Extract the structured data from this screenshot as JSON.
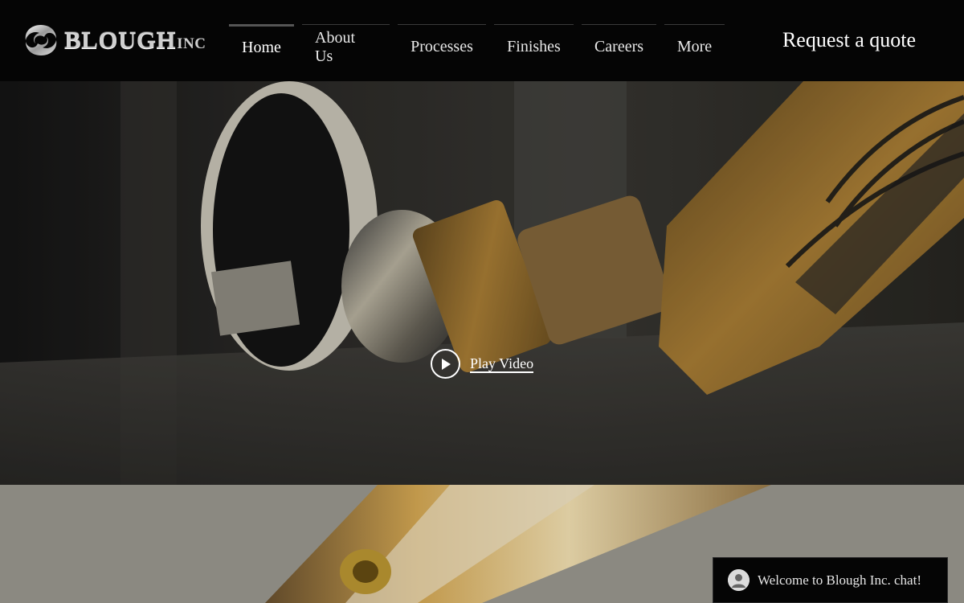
{
  "header": {
    "logo": {
      "name": "BLOUGH",
      "suffix": "INC",
      "icon": "swirl-logo-icon"
    },
    "nav": [
      {
        "label": "Home",
        "active": true
      },
      {
        "label": "About Us",
        "active": false
      },
      {
        "label": "Processes",
        "active": false
      },
      {
        "label": "Finishes",
        "active": false
      },
      {
        "label": "Careers",
        "active": false
      },
      {
        "label": "More",
        "active": false
      }
    ],
    "cta_label": "Request a quote"
  },
  "hero": {
    "play_label": "Play Video",
    "play_icon": "play-icon"
  },
  "chat": {
    "text": "Welcome to Blough Inc. chat!",
    "icon": "user-avatar-icon"
  },
  "colors": {
    "header_bg": "#050505",
    "text": "#ffffff",
    "robot_orange": "#c89a3c"
  }
}
